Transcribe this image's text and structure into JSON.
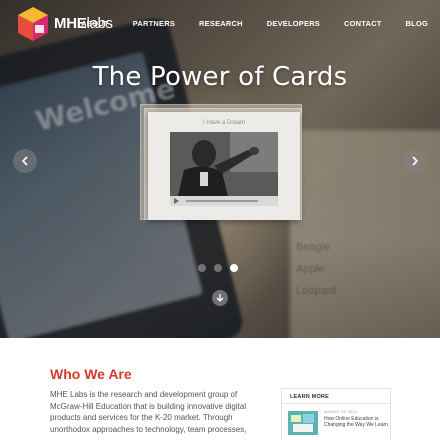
{
  "header": {
    "logo_name": "MHE",
    "logo_suffix": "labs",
    "nav": [
      "ABOUT",
      "PARTNERS",
      "RESEARCH",
      "DEVELOPERS",
      "CONTACT",
      "BLOG"
    ]
  },
  "hero": {
    "title": "The Power of Cards",
    "card_heading": "I Have a Dream",
    "background_text": "Welcome",
    "side_words": [
      "Beagle",
      "Apple",
      "Leopard"
    ],
    "slide_count": 3,
    "active_slide": 3,
    "icons": {
      "prev": "chevron-left-icon",
      "next": "chevron-right-icon",
      "scroll": "arrow-down-icon"
    }
  },
  "about": {
    "title": "Who We Are",
    "lines": [
      "MHE Labs is the research and development group of",
      "McGraw-Hill Education that is building innovative digital",
      "products and services for the K-20 market. Through",
      "unorthodox approaches to technology, team processes,"
    ]
  },
  "learn_more": {
    "title": "LEARN MORE",
    "date": "AUGUST 29, 2012",
    "headline": "How Online Education is Changing the Way We Learn"
  },
  "colors": {
    "accent_red": "#d63a2a",
    "logo_orange": "#f39c12",
    "logo_red": "#e74c3c",
    "logo_magenta": "#d6296b"
  }
}
